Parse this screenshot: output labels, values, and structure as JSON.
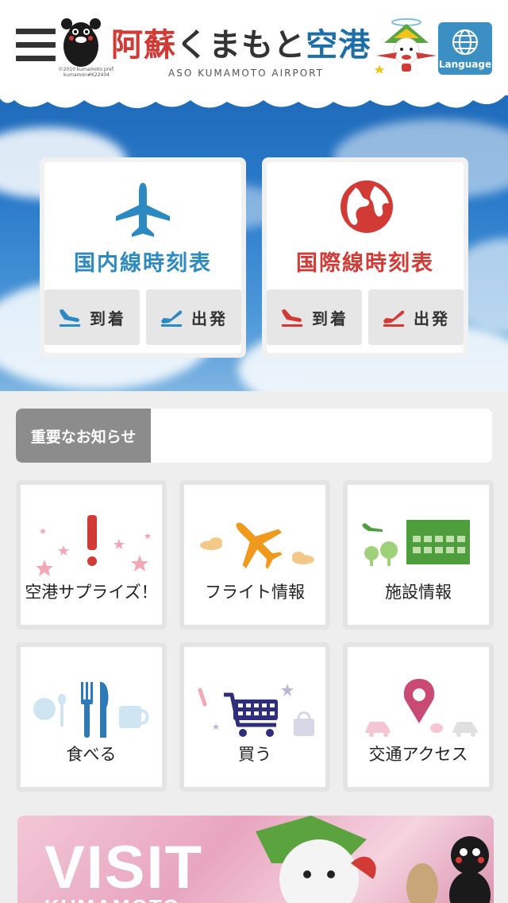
{
  "header": {
    "logo_jp": "阿蘇くまもと空港",
    "logo_en": "ASO KUMAMOTO AIRPORT",
    "copyright_line1": "©2010 kumamoto pref.",
    "copyright_line2": "kumamon#K22404",
    "language_label": "Language"
  },
  "timetables": {
    "domestic": {
      "title": "国内線時刻表",
      "arrival": "到着",
      "departure": "出発",
      "color": "#2d8ac0"
    },
    "international": {
      "title": "国際線時刻表",
      "arrival": "到着",
      "departure": "出発",
      "color": "#d23a36"
    }
  },
  "notice": {
    "label": "重要なお知らせ",
    "text": ""
  },
  "menu": [
    {
      "label": "空港サプライズ！",
      "icon": "exclamation-icon"
    },
    {
      "label": "フライト情報",
      "icon": "airplane-icon"
    },
    {
      "label": "施設情報",
      "icon": "terminal-building-icon"
    },
    {
      "label": "食べる",
      "icon": "fork-knife-icon"
    },
    {
      "label": "買う",
      "icon": "shopping-cart-icon"
    },
    {
      "label": "交通アクセス",
      "icon": "map-pin-icon"
    }
  ],
  "banner": {
    "title": "VISIT",
    "subtitle": "KUMAMOTO"
  },
  "colors": {
    "header_bg": "#ffffff",
    "language_btn": "#3b8fc2",
    "notice_label_bg": "#8c8c8c",
    "logo_red": "#d23a36",
    "logo_blue": "#1e6fa8"
  }
}
